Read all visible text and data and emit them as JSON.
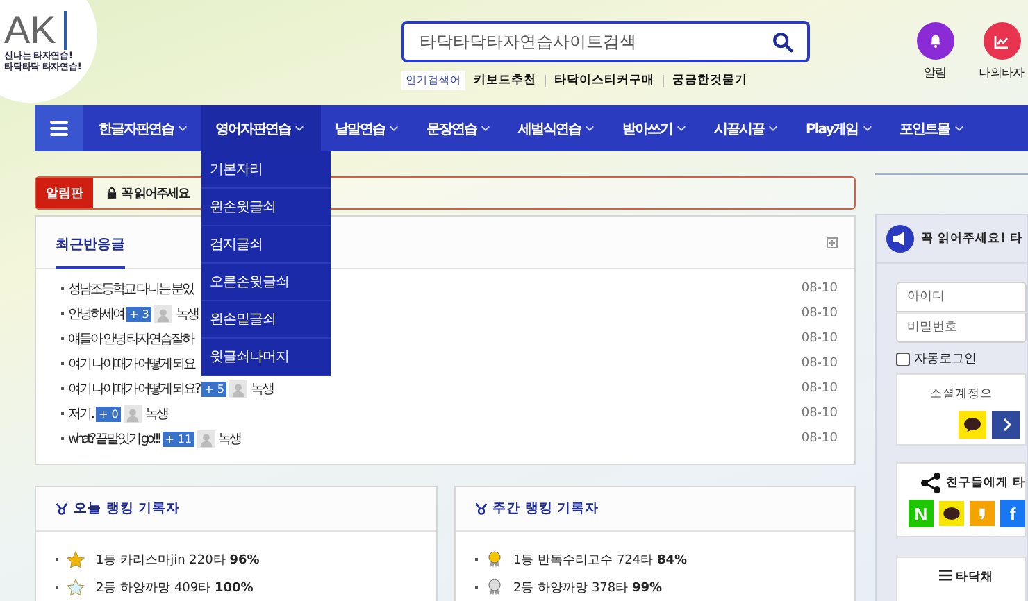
{
  "logo": {
    "mark": "AK",
    "tagline": [
      "신나는 타자연습!",
      "타닥타닥 타자연습!"
    ]
  },
  "search": {
    "placeholder": "타닥타닥타자연습사이트검색"
  },
  "popular": {
    "label": "인기검색어",
    "links": [
      "키보드추천",
      "타닥이스티커구매",
      "궁금한것묻기"
    ]
  },
  "quick": [
    {
      "label": "알림",
      "kind": "bell",
      "color": "#8a2bd6"
    },
    {
      "label": "나의타자",
      "kind": "chart",
      "color": "#e8344e"
    }
  ],
  "nav": {
    "items": [
      {
        "label": "한글자판연습",
        "selected": false
      },
      {
        "label": "영어자판연습",
        "selected": true
      },
      {
        "label": "낱말연습",
        "selected": false
      },
      {
        "label": "문장연습",
        "selected": false
      },
      {
        "label": "세벌식연습",
        "selected": false
      },
      {
        "label": "받아쓰기",
        "selected": false
      },
      {
        "label": "시끌시끌",
        "selected": false
      },
      {
        "label": "Play게임",
        "selected": false
      },
      {
        "label": "포인트몰",
        "selected": false
      }
    ]
  },
  "dropdown": {
    "items": [
      "기본자리",
      "윈손윗글쇠",
      "검지글쇠",
      "오른손윗글쇠",
      "왼손밑글쇠",
      "윗글쇠나머지"
    ]
  },
  "notice": {
    "badge": "알림판",
    "text": "꼭 읽어주세요"
  },
  "recent": {
    "tab": "최근반응글",
    "rows": [
      {
        "title": "성남조등학교 다니는 분있",
        "date": "08-10"
      },
      {
        "title": "안녕하세여",
        "count": "+ 3",
        "author": "녹생",
        "date": "08-10"
      },
      {
        "title": "얘들아 안녕 타자연습잘하",
        "date": "08-10"
      },
      {
        "title": "여기 나이때가 어떻게 되요",
        "date": "08-10"
      },
      {
        "title": "여기 나이때가 어떻게 되요?",
        "count": "+ 5",
        "author": "녹생",
        "date": "08-10"
      },
      {
        "title": "저기..",
        "count": "+ 0",
        "author": "녹생",
        "date": "08-10"
      },
      {
        "title": "what? 끝말잇기 go!!!",
        "count": "+ 11",
        "author": "녹생",
        "date": "08-10"
      }
    ]
  },
  "rankings": [
    {
      "title": "오늘 랭킹 기록자",
      "rows": [
        {
          "kind": "star",
          "color": "#f2b705",
          "rank": "1등",
          "name": "카리스마jin",
          "score": "220타",
          "accuracy": "96%"
        },
        {
          "kind": "star",
          "color": "#d8f0fb",
          "rank": "2등",
          "name": "하양까망",
          "score": "409타",
          "accuracy": "100%"
        }
      ]
    },
    {
      "title": "주간 랭킹 기록자",
      "rows": [
        {
          "kind": "ribbon",
          "color": "#f7c400",
          "rank": "1등",
          "name": "반독수리고수",
          "score": "724타",
          "accuracy": "84%"
        },
        {
          "kind": "ribbon",
          "color": "#dddddd",
          "rank": "2등",
          "name": "하양까망",
          "score": "378타",
          "accuracy": "99%"
        }
      ]
    }
  ],
  "sidebar": {
    "notice": "꼭 읽어주세요! 타",
    "login": {
      "id_placeholder": "아이디",
      "pw_placeholder": "비밀번호"
    },
    "auto_login": {
      "label": "자동로그인",
      "checked": false
    },
    "social": {
      "label": "소셜계정으"
    },
    "share": {
      "label": "친구들에게 타",
      "icons": [
        {
          "kind": "naver",
          "glyph": "N"
        },
        {
          "kind": "kakao"
        },
        {
          "kind": "story"
        },
        {
          "kind": "facebook",
          "glyph": "f"
        }
      ]
    },
    "chat": {
      "label": "타닥채"
    }
  }
}
